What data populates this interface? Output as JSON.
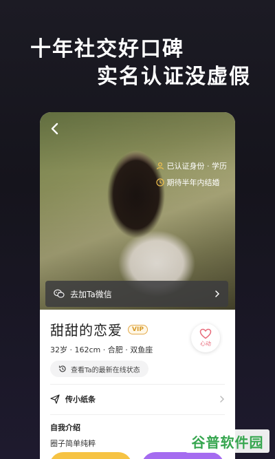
{
  "promo": {
    "line1": "十年社交好口碑",
    "line2": "实名认证没虚假"
  },
  "profile": {
    "tags": [
      "已认证身份 · 学历",
      "期待半年内结婚"
    ],
    "wechat_label": "去加Ta微信",
    "name": "甜甜的恋爱",
    "vip_label": "VIP",
    "like_label": "心动",
    "meta": "32岁 · 162cm · 合肥 · 双鱼座",
    "status_label": "查看Ta的最新在线状态",
    "note_label": "传小纸条",
    "intro_title": "自我介绍",
    "intro_text": "圈子简单纯粹"
  },
  "watermark": "谷普软件园",
  "colors": {
    "accent_pink": "#e86a7a",
    "vip_gold": "#d89b2a",
    "button_yellow": "#f6c344",
    "button_purple": "#a56cf0",
    "watermark_green": "#36a64f"
  }
}
